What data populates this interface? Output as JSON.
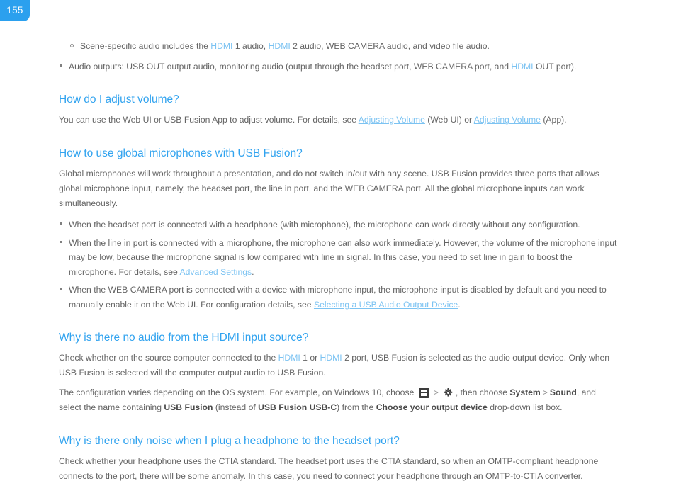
{
  "page": {
    "number": "155"
  },
  "top_list": {
    "sub_bullet": {
      "prefix": "Scene-specific audio includes the ",
      "kw1": "HDMI",
      "mid1": " 1 audio, ",
      "kw2": "HDMI",
      "suffix": " 2 audio, WEB CAMERA audio, and video file audio."
    },
    "main_bullet": {
      "prefix": "Audio outputs: USB OUT output audio, monitoring audio (output through the headset port, WEB CAMERA port, and ",
      "kw1": "HDMI",
      "suffix": " OUT port)."
    }
  },
  "sections": [
    {
      "heading": "How do I adjust volume?",
      "paragraph": {
        "prefix": "You can use the Web UI or USB Fusion App to adjust volume. For details, see ",
        "link1": "Adjusting Volume",
        "mid": " (Web UI) or ",
        "link2": "Adjusting Volume",
        "suffix": " (App)."
      }
    },
    {
      "heading": "How to use global microphones with USB Fusion?",
      "paragraph": "Global microphones will work throughout a presentation, and do not switch in/out with any scene. USB Fusion provides three ports that allows global microphone input, namely, the headset port, the line in port, and the WEB CAMERA port. All the global microphone inputs can work simultaneously.",
      "bullets": [
        {
          "text": "When the headset port is connected with a headphone (with microphone), the microphone can work directly without any configuration."
        },
        {
          "prefix": "When the line in port is connected with a microphone, the microphone can also work immediately. However, the volume of the microphone input may be low, because the microphone signal is low compared with line in signal. In this case, you need to set line in gain to boost the microphone. For details, see ",
          "link": "Advanced Settings",
          "suffix": "."
        },
        {
          "prefix": "When the WEB CAMERA port is connected with a device with microphone input, the microphone input is disabled by default and you need to manually enable it on the Web UI. For configuration details, see ",
          "link": "Selecting a USB Audio Output Device",
          "suffix": "."
        }
      ]
    },
    {
      "heading": "Why is there no audio from the  HDMI input source?",
      "paragraph_1": {
        "prefix": "Check whether on the source computer connected to the ",
        "kw1": "HDMI",
        "mid1": " 1 or ",
        "kw2": "HDMI",
        "suffix": " 2 port, USB Fusion is selected as the audio output device. Only when USB Fusion is selected will the computer output audio to USB Fusion."
      },
      "paragraph_2": {
        "prefix": "The configuration varies depending on the OS system. For example, on Windows 10, choose ",
        "icon_start": "windows-start-icon",
        "sep1": ">",
        "icon_settings": "gear-icon",
        "mid1": ", then choose ",
        "bold1": "System",
        "sep2": ">",
        "bold2": "Sound",
        "mid2": ", and select the name containing ",
        "bold3": "USB Fusion",
        "mid3": " (instead of ",
        "bold4": "USB Fusion USB-C",
        "mid4": ") from the ",
        "bold5": "Choose your output device",
        "suffix": " drop-down list box."
      }
    },
    {
      "heading": "Why is there only noise when I plug a headphone to the headset port?",
      "paragraph": "Check whether your headphone uses the CTIA standard. The headset port uses the CTIA standard, so when an OMTP-compliant headphone connects to the port, there will be some anomaly. In this case, you need to connect your headphone through an OMTP-to-CTIA converter."
    }
  ],
  "colors": {
    "badge_blue": "#2ba0ee",
    "heading_blue": "#31a3ef",
    "link_blue": "#7cc3f2",
    "body_gray": "#646464"
  }
}
